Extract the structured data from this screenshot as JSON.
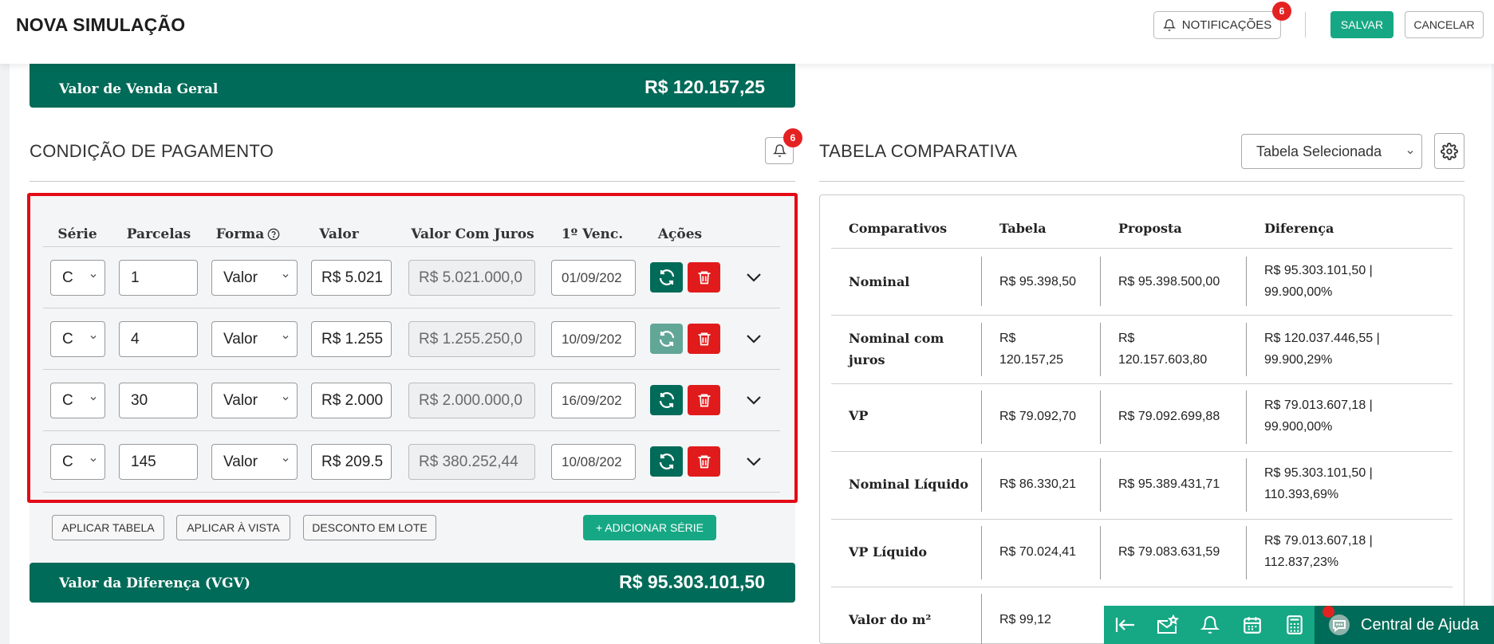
{
  "header": {
    "title": "NOVA SIMULAÇÃO",
    "notifications_label": "NOTIFICAÇÕES",
    "notifications_count": "6",
    "save_label": "SALVAR",
    "cancel_label": "CANCELAR"
  },
  "sales_total": {
    "label": "Valor de Venda Geral",
    "value": "R$ 120.157,25"
  },
  "payment": {
    "title": "CONDIÇÃO DE PAGAMENTO",
    "alert_count": "6",
    "columns": [
      "Série",
      "Parcelas",
      "Forma",
      "Valor",
      "Valor Com Juros",
      "1º Venc.",
      "Ações"
    ],
    "rows": [
      {
        "serie": "C",
        "parcelas": "1",
        "forma": "Valor",
        "valor": "R$ 5.021",
        "valor_juros": "R$ 5.021.000,0",
        "vencimento": "01/09/202",
        "refresh_enabled": true
      },
      {
        "serie": "C",
        "parcelas": "4",
        "forma": "Valor",
        "valor": "R$ 1.255",
        "valor_juros": "R$ 1.255.250,0",
        "vencimento": "10/09/202",
        "refresh_enabled": false
      },
      {
        "serie": "C",
        "parcelas": "30",
        "forma": "Valor",
        "valor": "R$ 2.000",
        "valor_juros": "R$ 2.000.000,0",
        "vencimento": "16/09/202",
        "refresh_enabled": true
      },
      {
        "serie": "C",
        "parcelas": "145",
        "forma": "Valor",
        "valor": "R$ 209.5",
        "valor_juros": "R$ 380.252,44",
        "vencimento": "10/08/202",
        "refresh_enabled": true
      }
    ],
    "apply_table_label": "APLICAR TABELA",
    "apply_cash_label": "APLICAR À VISTA",
    "batch_discount_label": "DESCONTO EM LOTE",
    "add_series_label": "+ ADICIONAR SÉRIE"
  },
  "difference_total": {
    "label": "Valor da Diferença (VGV)",
    "value": "R$ 95.303.101,50"
  },
  "comparative": {
    "title": "TABELA COMPARATIVA",
    "select_value": "Tabela Selecionada",
    "columns": [
      "Comparativos",
      "Tabela",
      "Proposta",
      "Diferença"
    ],
    "rows": [
      {
        "name": [
          "Nominal"
        ],
        "tabela": [
          "R$ 95.398,50"
        ],
        "proposta": [
          "R$ 95.398.500,00"
        ],
        "diferenca": [
          "R$ 95.303.101,50 |",
          "99.900,00%"
        ]
      },
      {
        "name": [
          "Nominal com",
          "juros"
        ],
        "tabela": [
          "R$",
          "120.157,25"
        ],
        "proposta": [
          "R$",
          "120.157.603,80"
        ],
        "diferenca": [
          "R$ 120.037.446,55 |",
          "99.900,29%"
        ]
      },
      {
        "name": [
          "VP"
        ],
        "tabela": [
          "R$ 79.092,70"
        ],
        "proposta": [
          "R$ 79.092.699,88"
        ],
        "diferenca": [
          "R$ 79.013.607,18 |",
          "99.900,00%"
        ]
      },
      {
        "name": [
          "Nominal Líquido"
        ],
        "tabela": [
          "R$ 86.330,21"
        ],
        "proposta": [
          "R$ 95.389.431,71"
        ],
        "diferenca": [
          "R$ 95.303.101,50 |",
          "110.393,69%"
        ]
      },
      {
        "name": [
          "VP Líquido"
        ],
        "tabela": [
          "R$ 70.024,41"
        ],
        "proposta": [
          "R$ 79.083.631,59"
        ],
        "diferenca": [
          "R$ 79.013.607,18 |",
          "112.837,23%"
        ]
      },
      {
        "name": [
          "Valor do m²"
        ],
        "tabela": [
          "R$ 99,12"
        ],
        "proposta": [
          ""
        ],
        "diferenca": [
          ""
        ]
      }
    ]
  },
  "help": {
    "label": "Central de Ajuda"
  },
  "colors": {
    "brand_dark": "#006b58",
    "brand": "#16a884",
    "danger": "#e11b1b",
    "highlight": "#e30a17"
  }
}
